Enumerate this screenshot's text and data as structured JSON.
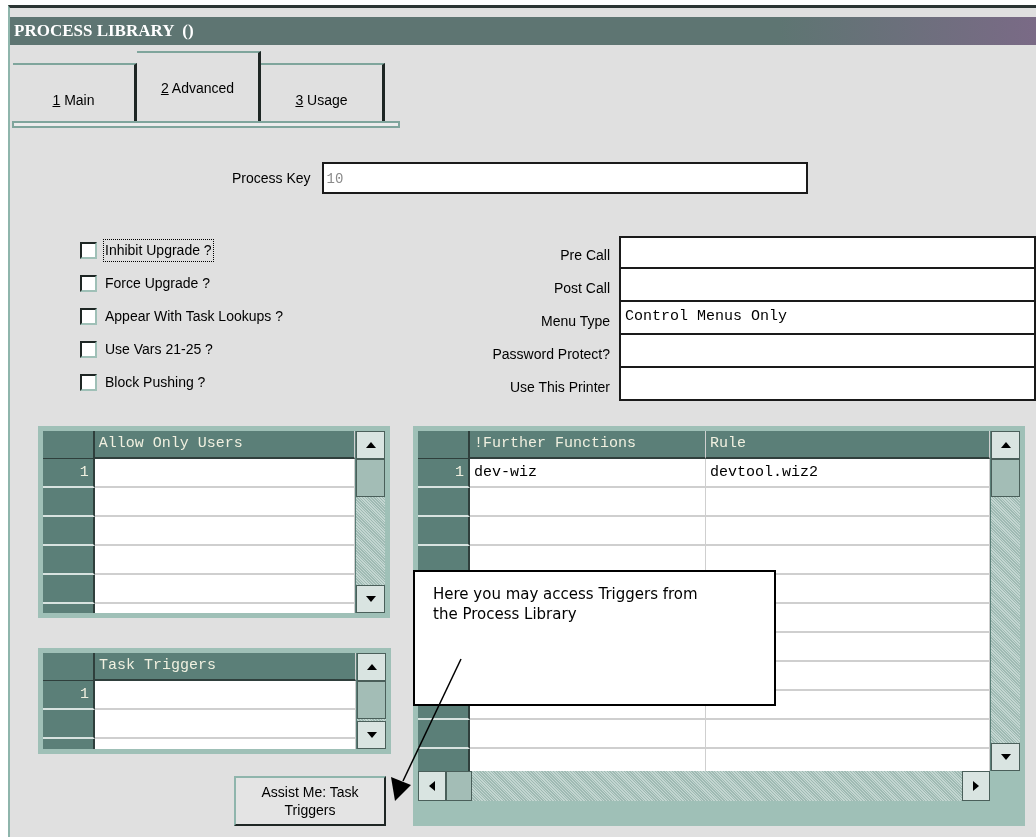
{
  "window": {
    "title": "PROCESS LIBRARY  ()"
  },
  "tabs": [
    {
      "key": "1",
      "label": " Main",
      "selected": false
    },
    {
      "key": "2",
      "label": " Advanced",
      "selected": true
    },
    {
      "key": "3",
      "label": " Usage",
      "selected": false
    }
  ],
  "process_key": {
    "label": "Process Key",
    "value": "10"
  },
  "options": [
    {
      "label": "Inhibit Upgrade ?",
      "checked": false,
      "focused": true
    },
    {
      "label": "Force Upgrade ?",
      "checked": false,
      "focused": false
    },
    {
      "label": "Appear With Task Lookups ?",
      "checked": false,
      "focused": false
    },
    {
      "label": "Use Vars 21-25 ?",
      "checked": false,
      "focused": false
    },
    {
      "label": "Block Pushing ?",
      "checked": false,
      "focused": false
    }
  ],
  "fields": [
    {
      "label": "Pre Call"
    },
    {
      "label": "Post Call"
    },
    {
      "label": "Menu Type",
      "value": "Control Menus Only"
    },
    {
      "label": "Password Protect?"
    },
    {
      "label": "Use This Printer"
    }
  ],
  "allow_users_grid": {
    "columns": [
      "Allow Only Users"
    ],
    "rows": [
      {
        "number": "1"
      }
    ]
  },
  "task_triggers_grid": {
    "columns": [
      "Task Triggers"
    ],
    "rows": [
      {
        "number": "1"
      }
    ]
  },
  "functions_grid": {
    "columns": [
      "!Further Functions",
      "Rule"
    ],
    "rows": [
      {
        "number": "1",
        "cells": [
          "dev-wiz",
          "devtool.wiz2"
        ]
      }
    ]
  },
  "assist_button": {
    "label": "Assist Me: Task Triggers"
  },
  "callout": {
    "text": "Here you may access Triggers from the Process Library"
  }
}
